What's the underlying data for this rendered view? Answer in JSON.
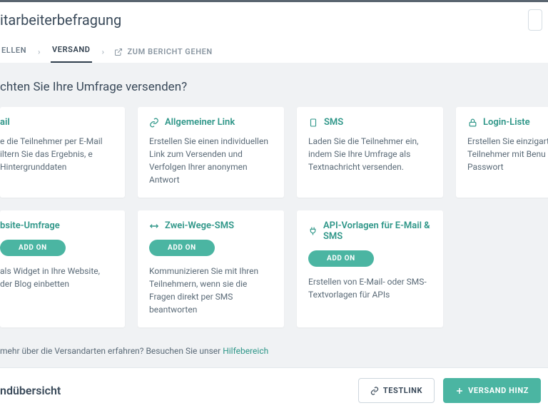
{
  "header": {
    "title": "itarbeiterbefragung"
  },
  "tabs": {
    "create": "ELLEN",
    "send": "VERSAND",
    "report": "ZUM BERICHT GEHEN"
  },
  "section": {
    "heading": "chten Sie Ihre Umfrage versenden?"
  },
  "cards_row1": {
    "email": {
      "title": "ail",
      "desc": "e die Teilnehmer per E-Mail iltern Sie das Ergebnis, e Hintergrunddaten"
    },
    "link": {
      "title": "Allgemeiner Link",
      "desc": "Erstellen Sie einen individuellen Link zum Versenden und Verfolgen Ihrer anonymen Antwort"
    },
    "sms": {
      "title": "SMS",
      "desc": "Laden Sie die Teilnehmer ein, indem Sie Ihre Umfrage als Textnachricht versenden."
    },
    "login": {
      "title": "Login-Liste",
      "desc": "Erstellen Sie einzigartige L Ihre Teilnehmer mit Benu und Passwort"
    }
  },
  "cards_row2": {
    "website": {
      "title": "bsite-Umfrage",
      "addon": "ADD ON",
      "desc": "als Widget in Ihre Website, der Blog einbetten"
    },
    "twoway": {
      "title": "Zwei-Wege-SMS",
      "addon": "ADD ON",
      "desc": "Kommunizieren Sie mit Ihren Teilnehmern, wenn sie die Fragen direkt per SMS beantworten"
    },
    "api": {
      "title": "API-Vorlagen für E-Mail & SMS",
      "addon": "ADD ON",
      "desc": "Erstellen von E-Mail- oder SMS-Textvorlagen für APIs"
    }
  },
  "help": {
    "prefix": "mehr über die Versandarten erfahren? Besuchen Sie unser ",
    "link": "Hilfebereich"
  },
  "footer": {
    "title": "ndübersicht",
    "testlink": "TESTLINK",
    "add": "VERSAND HINZ"
  }
}
